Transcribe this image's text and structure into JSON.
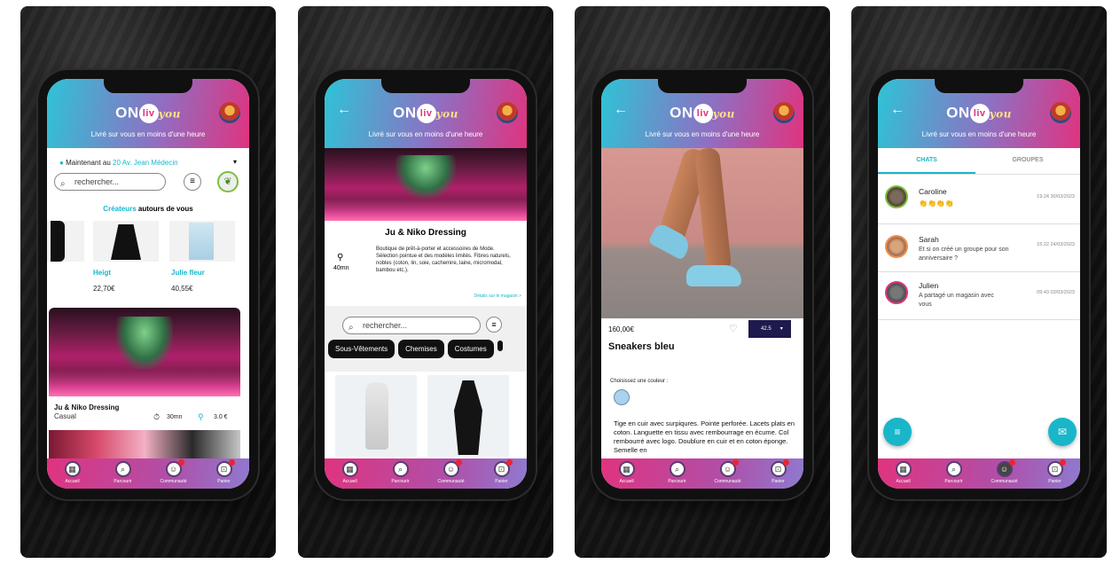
{
  "app": {
    "logo_on": "ON",
    "logo_liv": "liv",
    "logo_you": "you",
    "tagline": "Livré sur vous en moins d'une heure"
  },
  "tabbar": {
    "home": "Accueil",
    "browse": "Parcourir",
    "community": "Communauté",
    "cart": "Panier"
  },
  "screen1": {
    "location_prefix": "Maintenant au",
    "location_value": "20 Av. Jean Médecin",
    "search_placeholder": "rechercher...",
    "section_title_accent": "Créateurs",
    "section_title_rest": "autours de vous",
    "products": [
      {
        "name": "Heigt",
        "price": "22,70€"
      },
      {
        "name": "Julie fleur",
        "price": "40,55€"
      }
    ],
    "store_name": "Ju & Niko Dressing",
    "store_style": "Casual",
    "store_time": "30mn",
    "store_fee": "3.0 €"
  },
  "screen2": {
    "store_name": "Ju & Niko Dressing",
    "delivery_time": "40mn",
    "description": "Boutique de prêt-à-porter et accessoires de Mode. Sélection pointue et des modèles limités. Fibres naturels, nobles (coton, lin, soie, cachemire, laine, micromodal, bambou etc.).",
    "details_link": "Détails sur le magasin >",
    "search_placeholder": "rechercher...",
    "categories": [
      "Sous-Vêtements",
      "Chemises",
      "Costumes"
    ]
  },
  "screen3": {
    "price": "160,00€",
    "size_value": "42.5",
    "product_name": "Sneakers bleu",
    "color_label": "Choisissez une couleur :",
    "description": "Tige en cuir avec surpiqures. Pointe perforée. Lacets plats en coton. Languette en tissu avec rembourrage en écume. Col rembourré avec logo. Doublure en cuir et en coton éponge. Semelle en"
  },
  "screen4": {
    "tab_chats": "CHATS",
    "tab_groups": "GROUPES",
    "chats": [
      {
        "name": "Caroline",
        "message": "👏👏👏👏",
        "time": "19:24 30/03/2023"
      },
      {
        "name": "Sarah",
        "message": "Et si on créé un groupe pour son anniversaire ?",
        "time": "16:22 24/03/2023"
      },
      {
        "name": "Julien",
        "message": "A partagé un magasin avec vous",
        "time": "09:43 03/03/2023"
      }
    ]
  },
  "colors": {
    "accent_cyan": "#2ec3d6",
    "accent_pink": "#e0337f",
    "accent_teal": "#19b6c9"
  }
}
